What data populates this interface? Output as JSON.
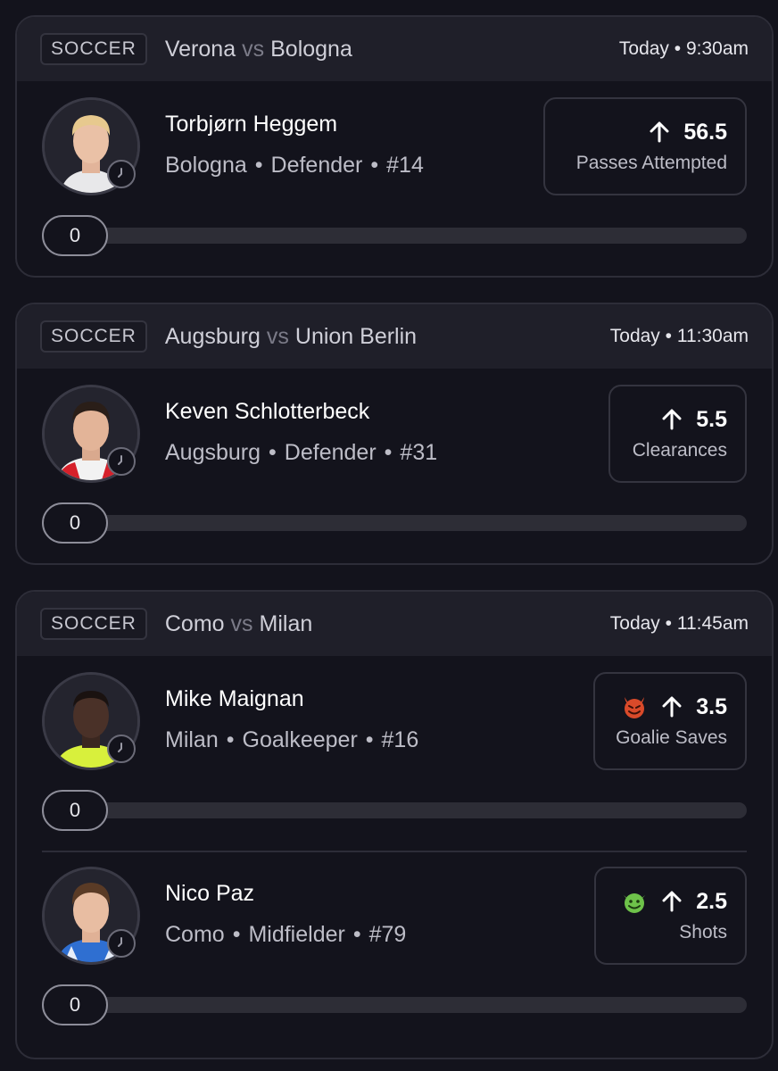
{
  "cards": [
    {
      "sport": "SOCCER",
      "home": "Verona",
      "vs": "vs",
      "away": "Bologna",
      "time": "Today • 9:30am",
      "picks": [
        {
          "name": "Torbjørn Heggem",
          "team": "Bologna",
          "sep1": "•",
          "position": "Defender",
          "sep2": "•",
          "number": "#14",
          "line": "56.5",
          "stat": "Passes Attempted",
          "progress": "0",
          "progress_fraction": 0
        }
      ]
    },
    {
      "sport": "SOCCER",
      "home": "Augsburg",
      "vs": "vs",
      "away": "Union Berlin",
      "time": "Today • 11:30am",
      "picks": [
        {
          "name": "Keven Schlotterbeck",
          "team": "Augsburg",
          "sep1": "•",
          "position": "Defender",
          "sep2": "•",
          "number": "#31",
          "line": "5.5",
          "stat": "Clearances",
          "progress": "0",
          "progress_fraction": 0
        }
      ]
    },
    {
      "sport": "SOCCER",
      "home": "Como",
      "vs": "vs",
      "away": "Milan",
      "time": "Today • 11:45am",
      "picks": [
        {
          "name": "Mike Maignan",
          "team": "Milan",
          "sep1": "•",
          "position": "Goalkeeper",
          "sep2": "•",
          "number": "#16",
          "line": "3.5",
          "stat": "Goalie Saves",
          "emoji_icon": "red-devil-face-icon",
          "progress": "0",
          "progress_fraction": 0
        },
        {
          "name": "Nico Paz",
          "team": "Como",
          "sep1": "•",
          "position": "Midfielder",
          "sep2": "•",
          "number": "#79",
          "line": "2.5",
          "stat": "Shots",
          "emoji_icon": "green-goblin-face-icon",
          "progress": "0",
          "progress_fraction": 0
        }
      ]
    }
  ],
  "colors": {
    "background": "#13131c",
    "header": "#1f1f29",
    "border": "#2d2d38",
    "text_primary": "#ffffff",
    "text_secondary": "#bdbdc7",
    "vs_text": "#7b7b88",
    "devil_red": "#d94a2a",
    "goblin_green": "#6ec24a"
  }
}
